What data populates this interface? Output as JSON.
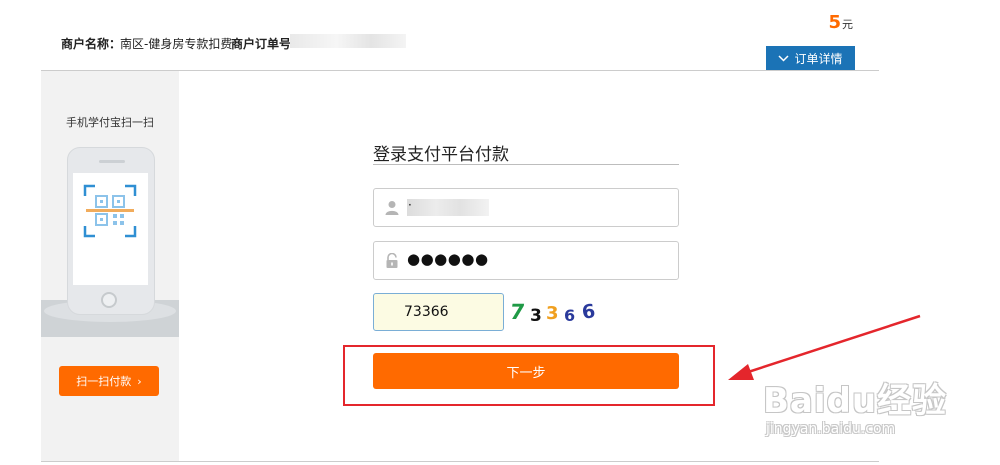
{
  "header": {
    "merchant_label": "商户名称：",
    "merchant_name": "南区-健身房专款扣费",
    "order_label": "商户订单号",
    "amount_value": "5",
    "amount_unit": "元",
    "order_detail_label": "订单详情"
  },
  "left_panel": {
    "scan_title": "手机学付宝扫一扫",
    "scan_pay_label": "扫一扫付款",
    "scan_pay_chevron": "›"
  },
  "form": {
    "title": "登录支付平台付款",
    "account_value": "·",
    "password_value": "●●●●●●",
    "captcha_value": "73366",
    "captcha_chars": [
      "7",
      "3",
      "3",
      "6",
      "6"
    ],
    "next_label": "下一步"
  },
  "annotation": {
    "highlight_color": "#e4262c"
  },
  "watermark": {
    "logo": "Baidu经验",
    "url": "jingyan.baidu.com"
  },
  "colors": {
    "accent": "#ff6a00",
    "detail_button": "#1b73b6"
  },
  "icons": [
    "chevron-down-icon",
    "user-icon",
    "lock-icon",
    "qr-scan-icon",
    "chevron-right-icon",
    "arrow-icon"
  ]
}
